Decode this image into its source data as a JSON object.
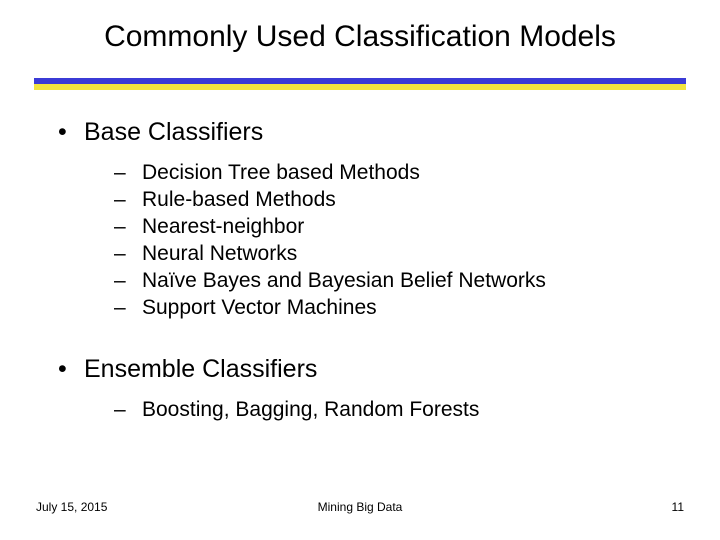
{
  "title": "Commonly Used Classification Models",
  "sections": [
    {
      "heading": "Base Classifiers",
      "items": [
        "Decision Tree based Methods",
        "Rule-based Methods",
        "Nearest-neighbor",
        "Neural Networks",
        "Naïve Bayes and Bayesian Belief Networks",
        "Support Vector Machines"
      ]
    },
    {
      "heading": "Ensemble Classifiers",
      "items": [
        "Boosting, Bagging, Random Forests"
      ]
    }
  ],
  "footer": {
    "date": "July 15, 2015",
    "center": "Mining Big Data",
    "page": "11"
  }
}
